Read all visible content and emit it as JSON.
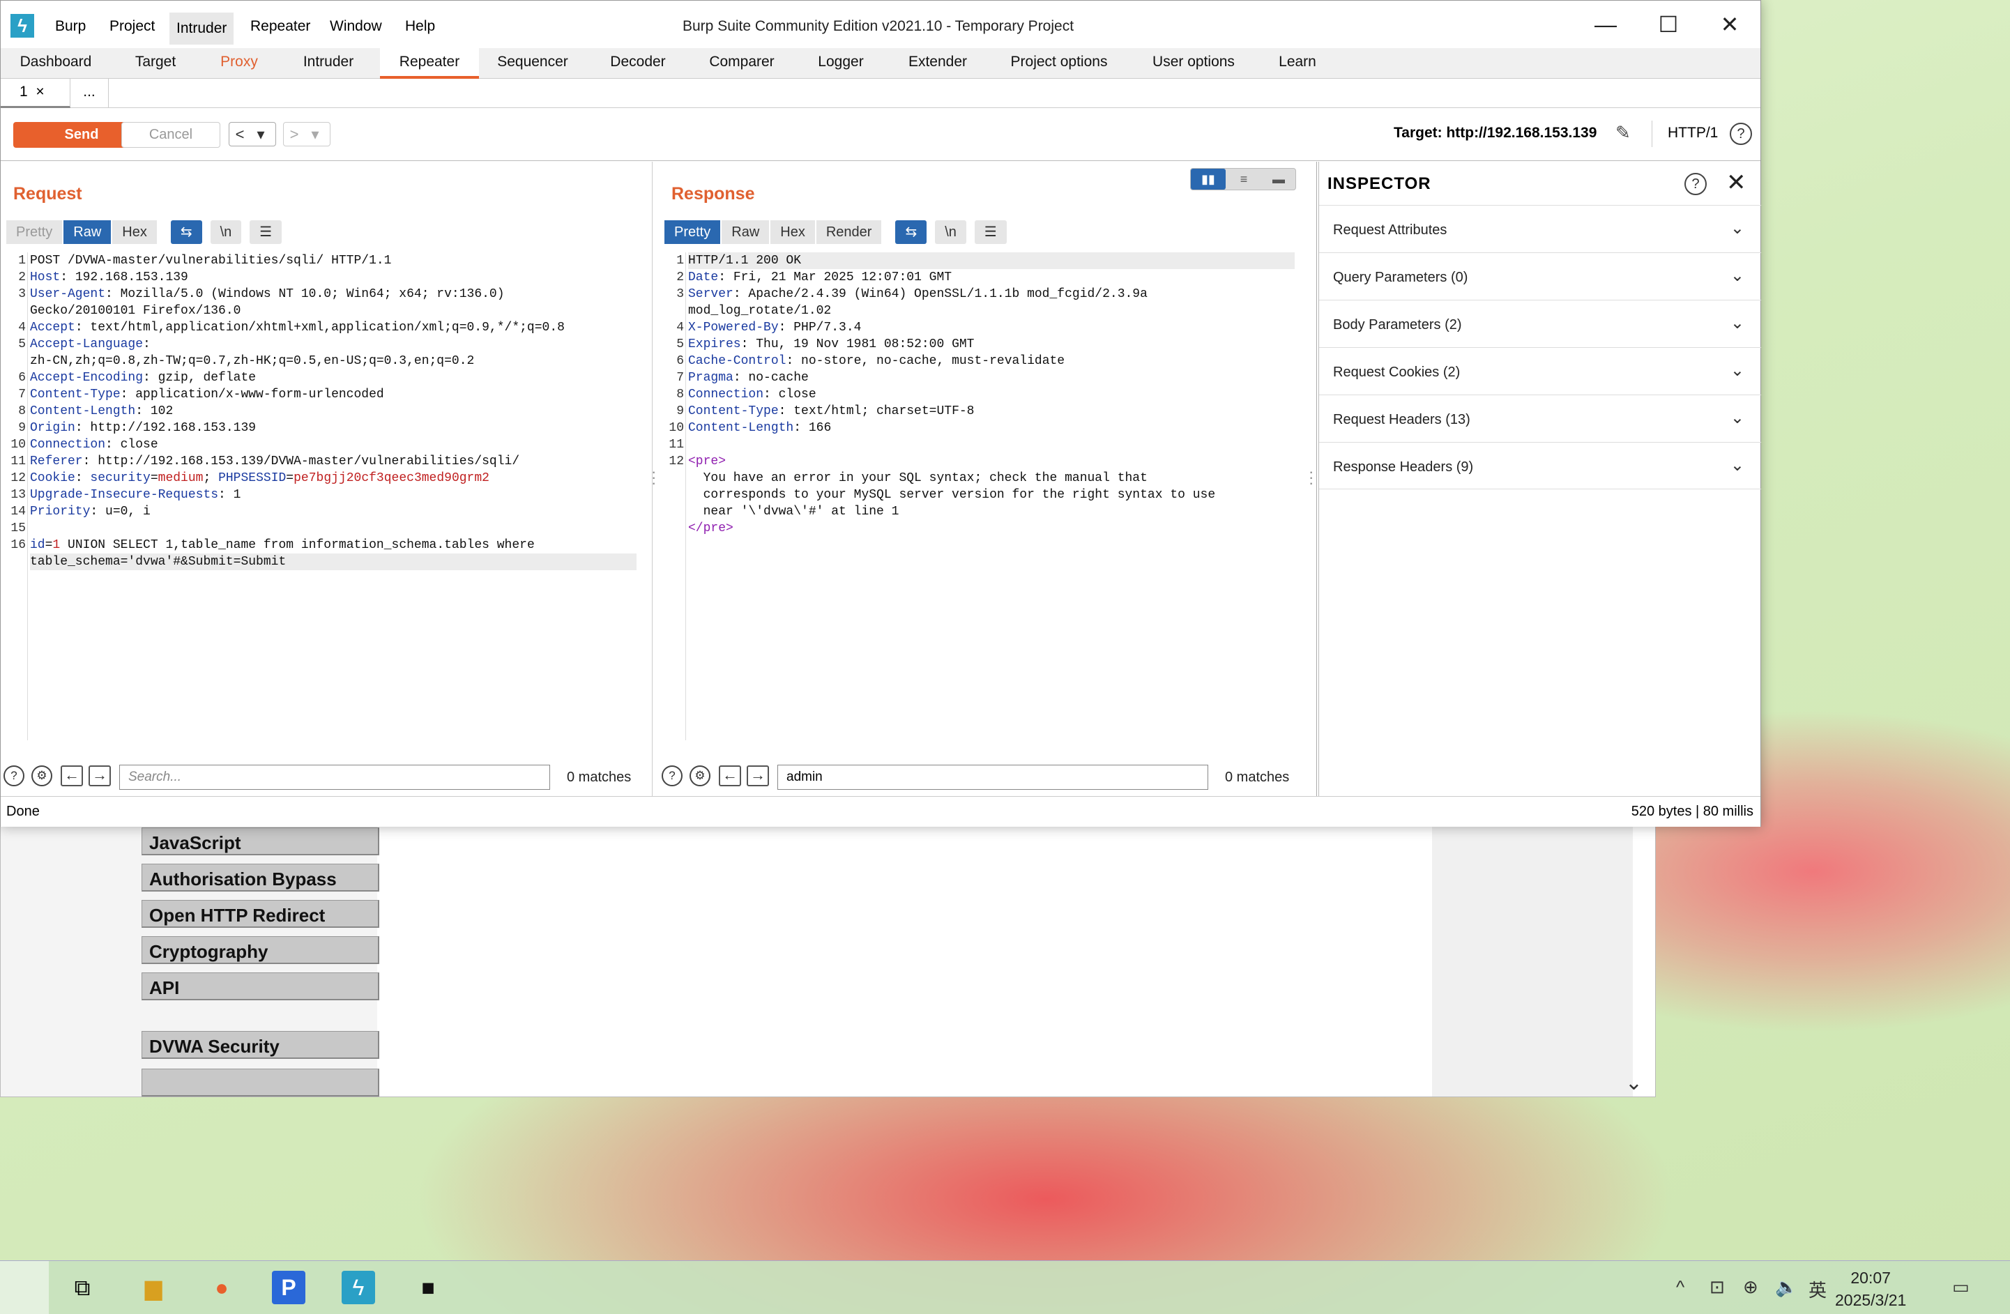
{
  "browser": {
    "menu": [
      "JavaScript",
      "Authorisation Bypass",
      "Open HTTP Redirect",
      "Cryptography",
      "API",
      "DVWA Security"
    ]
  },
  "app": {
    "title": "Burp Suite Community Edition v2021.10 - Temporary Project",
    "menubar": [
      "Burp",
      "Project",
      "Intruder",
      "Repeater",
      "Window",
      "Help"
    ],
    "window_controls": {
      "minimize": "—",
      "maximize": "☐",
      "close": "✕"
    }
  },
  "tabs": [
    "Dashboard",
    "Target",
    "Proxy",
    "Intruder",
    "Repeater",
    "Sequencer",
    "Decoder",
    "Comparer",
    "Logger",
    "Extender",
    "Project options",
    "User options",
    "Learn"
  ],
  "subtabs": {
    "first": "1",
    "close": "×",
    "more": "..."
  },
  "toolbar": {
    "send": "Send",
    "cancel": "Cancel",
    "back": "<",
    "forward": ">",
    "dropdown": "▾",
    "target": "Target: http://192.168.153.139",
    "protocol": "HTTP/1",
    "help": "?"
  },
  "request": {
    "title": "Request",
    "views": [
      "Pretty",
      "Raw",
      "Hex"
    ],
    "wrap_icon": "⇆",
    "newline_label": "\\n",
    "menu_icon": "☰",
    "search_placeholder": "Search...",
    "matches": "0 matches"
  },
  "response": {
    "title": "Response",
    "views": [
      "Pretty",
      "Raw",
      "Hex",
      "Render"
    ],
    "wrap_icon": "⇆",
    "newline_label": "\\n",
    "menu_icon": "☰",
    "search_value": "admin",
    "matches": "0 matches"
  },
  "inspector": {
    "title": "INSPECTOR",
    "help": "?",
    "close": "✕",
    "sections": [
      "Request Attributes",
      "Query Parameters (0)",
      "Body Parameters (2)",
      "Request Cookies (2)",
      "Request Headers (13)",
      "Response Headers (9)"
    ],
    "chevron": "⌄"
  },
  "status": {
    "left": "Done",
    "right": "520 bytes | 80 millis"
  },
  "taskbar": {
    "time": "20:07",
    "date": "2025/3/21",
    "ime": "英"
  },
  "colors": {
    "accent": "#e8602c",
    "selected_blue": "#2a68b0",
    "header_key": "#1a3aa0",
    "param_value": "#c02020",
    "html_tag": "#9020b0"
  }
}
